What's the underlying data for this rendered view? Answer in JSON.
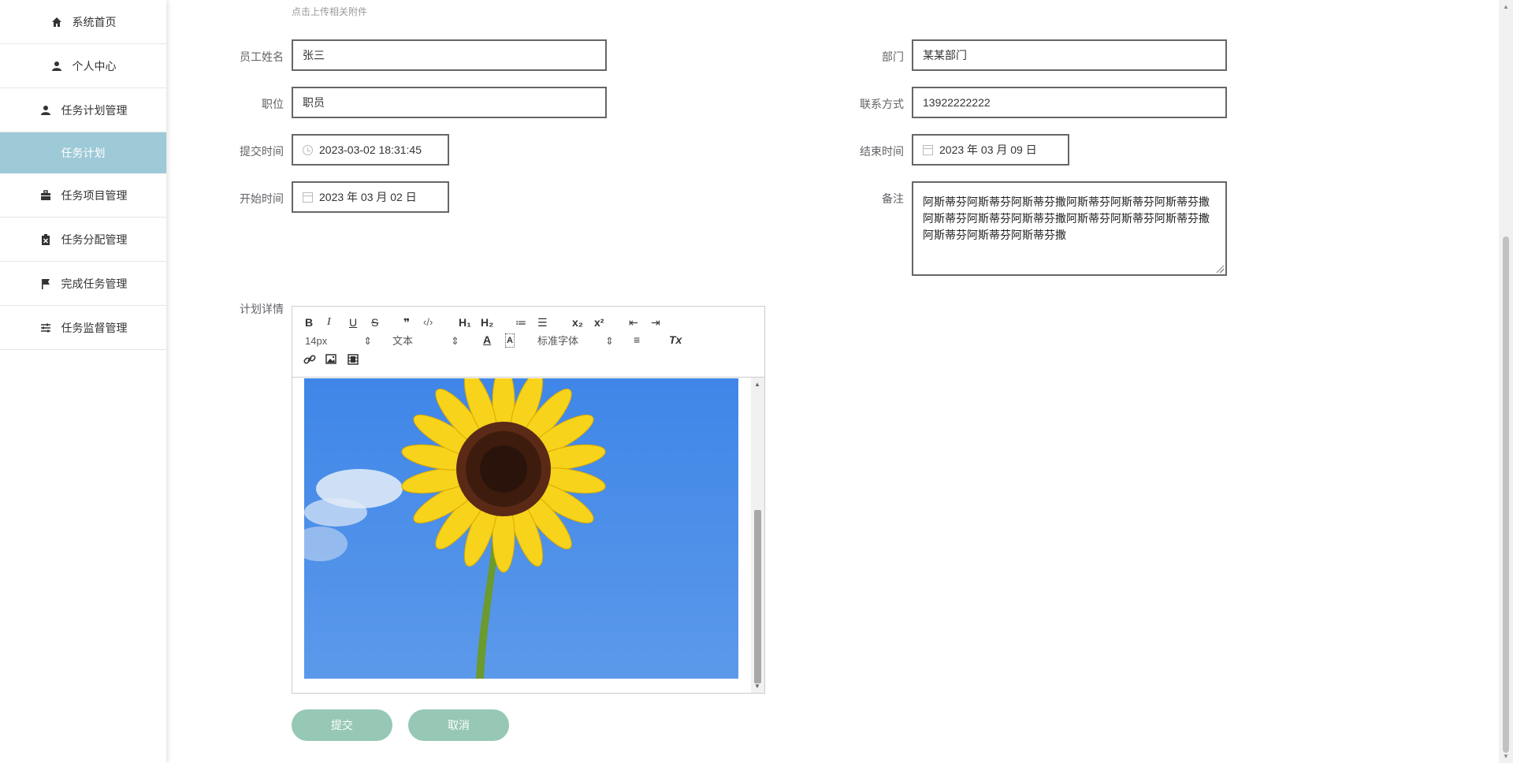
{
  "sidebar": {
    "items": [
      {
        "label": "系统首页",
        "icon": "home-icon"
      },
      {
        "label": "个人中心",
        "icon": "user-icon"
      },
      {
        "label": "任务计划管理",
        "icon": "user-icon"
      },
      {
        "label": "任务计划",
        "icon": null,
        "active": true
      },
      {
        "label": "任务项目管理",
        "icon": "briefcase-icon"
      },
      {
        "label": "任务分配管理",
        "icon": "clipboard-x-icon"
      },
      {
        "label": "完成任务管理",
        "icon": "flag-icon"
      },
      {
        "label": "任务监督管理",
        "icon": "sliders-icon"
      }
    ]
  },
  "form": {
    "upload_hint": "点击上传相关附件",
    "employee_name": {
      "label": "员工姓名",
      "value": "张三"
    },
    "department": {
      "label": "部门",
      "value": "某某部门"
    },
    "position": {
      "label": "职位",
      "value": "职员"
    },
    "contact": {
      "label": "联系方式",
      "value": "13922222222"
    },
    "submit_time": {
      "label": "提交时间",
      "value": "2023-03-02 18:31:45"
    },
    "end_time": {
      "label": "结束时间",
      "value": "2023 年 03 月 09 日"
    },
    "start_time": {
      "label": "开始时间",
      "value": "2023 年 03 月 02 日"
    },
    "remark": {
      "label": "备注",
      "value": "阿斯蒂芬阿斯蒂芬阿斯蒂芬撒阿斯蒂芬阿斯蒂芬阿斯蒂芬撒阿斯蒂芬阿斯蒂芬阿斯蒂芬撒阿斯蒂芬阿斯蒂芬阿斯蒂芬撒阿斯蒂芬阿斯蒂芬阿斯蒂芬撒"
    },
    "plan_detail": {
      "label": "计划详情"
    }
  },
  "editor": {
    "font_size": "14px",
    "block_type": "文本",
    "font_family": "标准字体",
    "toolbar_glyphs": {
      "bold": "B",
      "italic": "I",
      "underline": "U",
      "strike": "S",
      "quote": "❞",
      "code": "‹/›",
      "h1": "H₁",
      "h2": "H₂",
      "ol": "≔",
      "ul": "☰",
      "sub": "x₂",
      "sup": "x²",
      "outdent": "⇤",
      "indent": "⇥",
      "color": "A",
      "bg": "A",
      "align": "≡",
      "clear": "Tx"
    }
  },
  "actions": {
    "submit": "提交",
    "cancel": "取消"
  },
  "colors": {
    "sidebar_active": "#9ec9d6",
    "button": "#96c8b5",
    "sky": "#4f8fe6"
  }
}
